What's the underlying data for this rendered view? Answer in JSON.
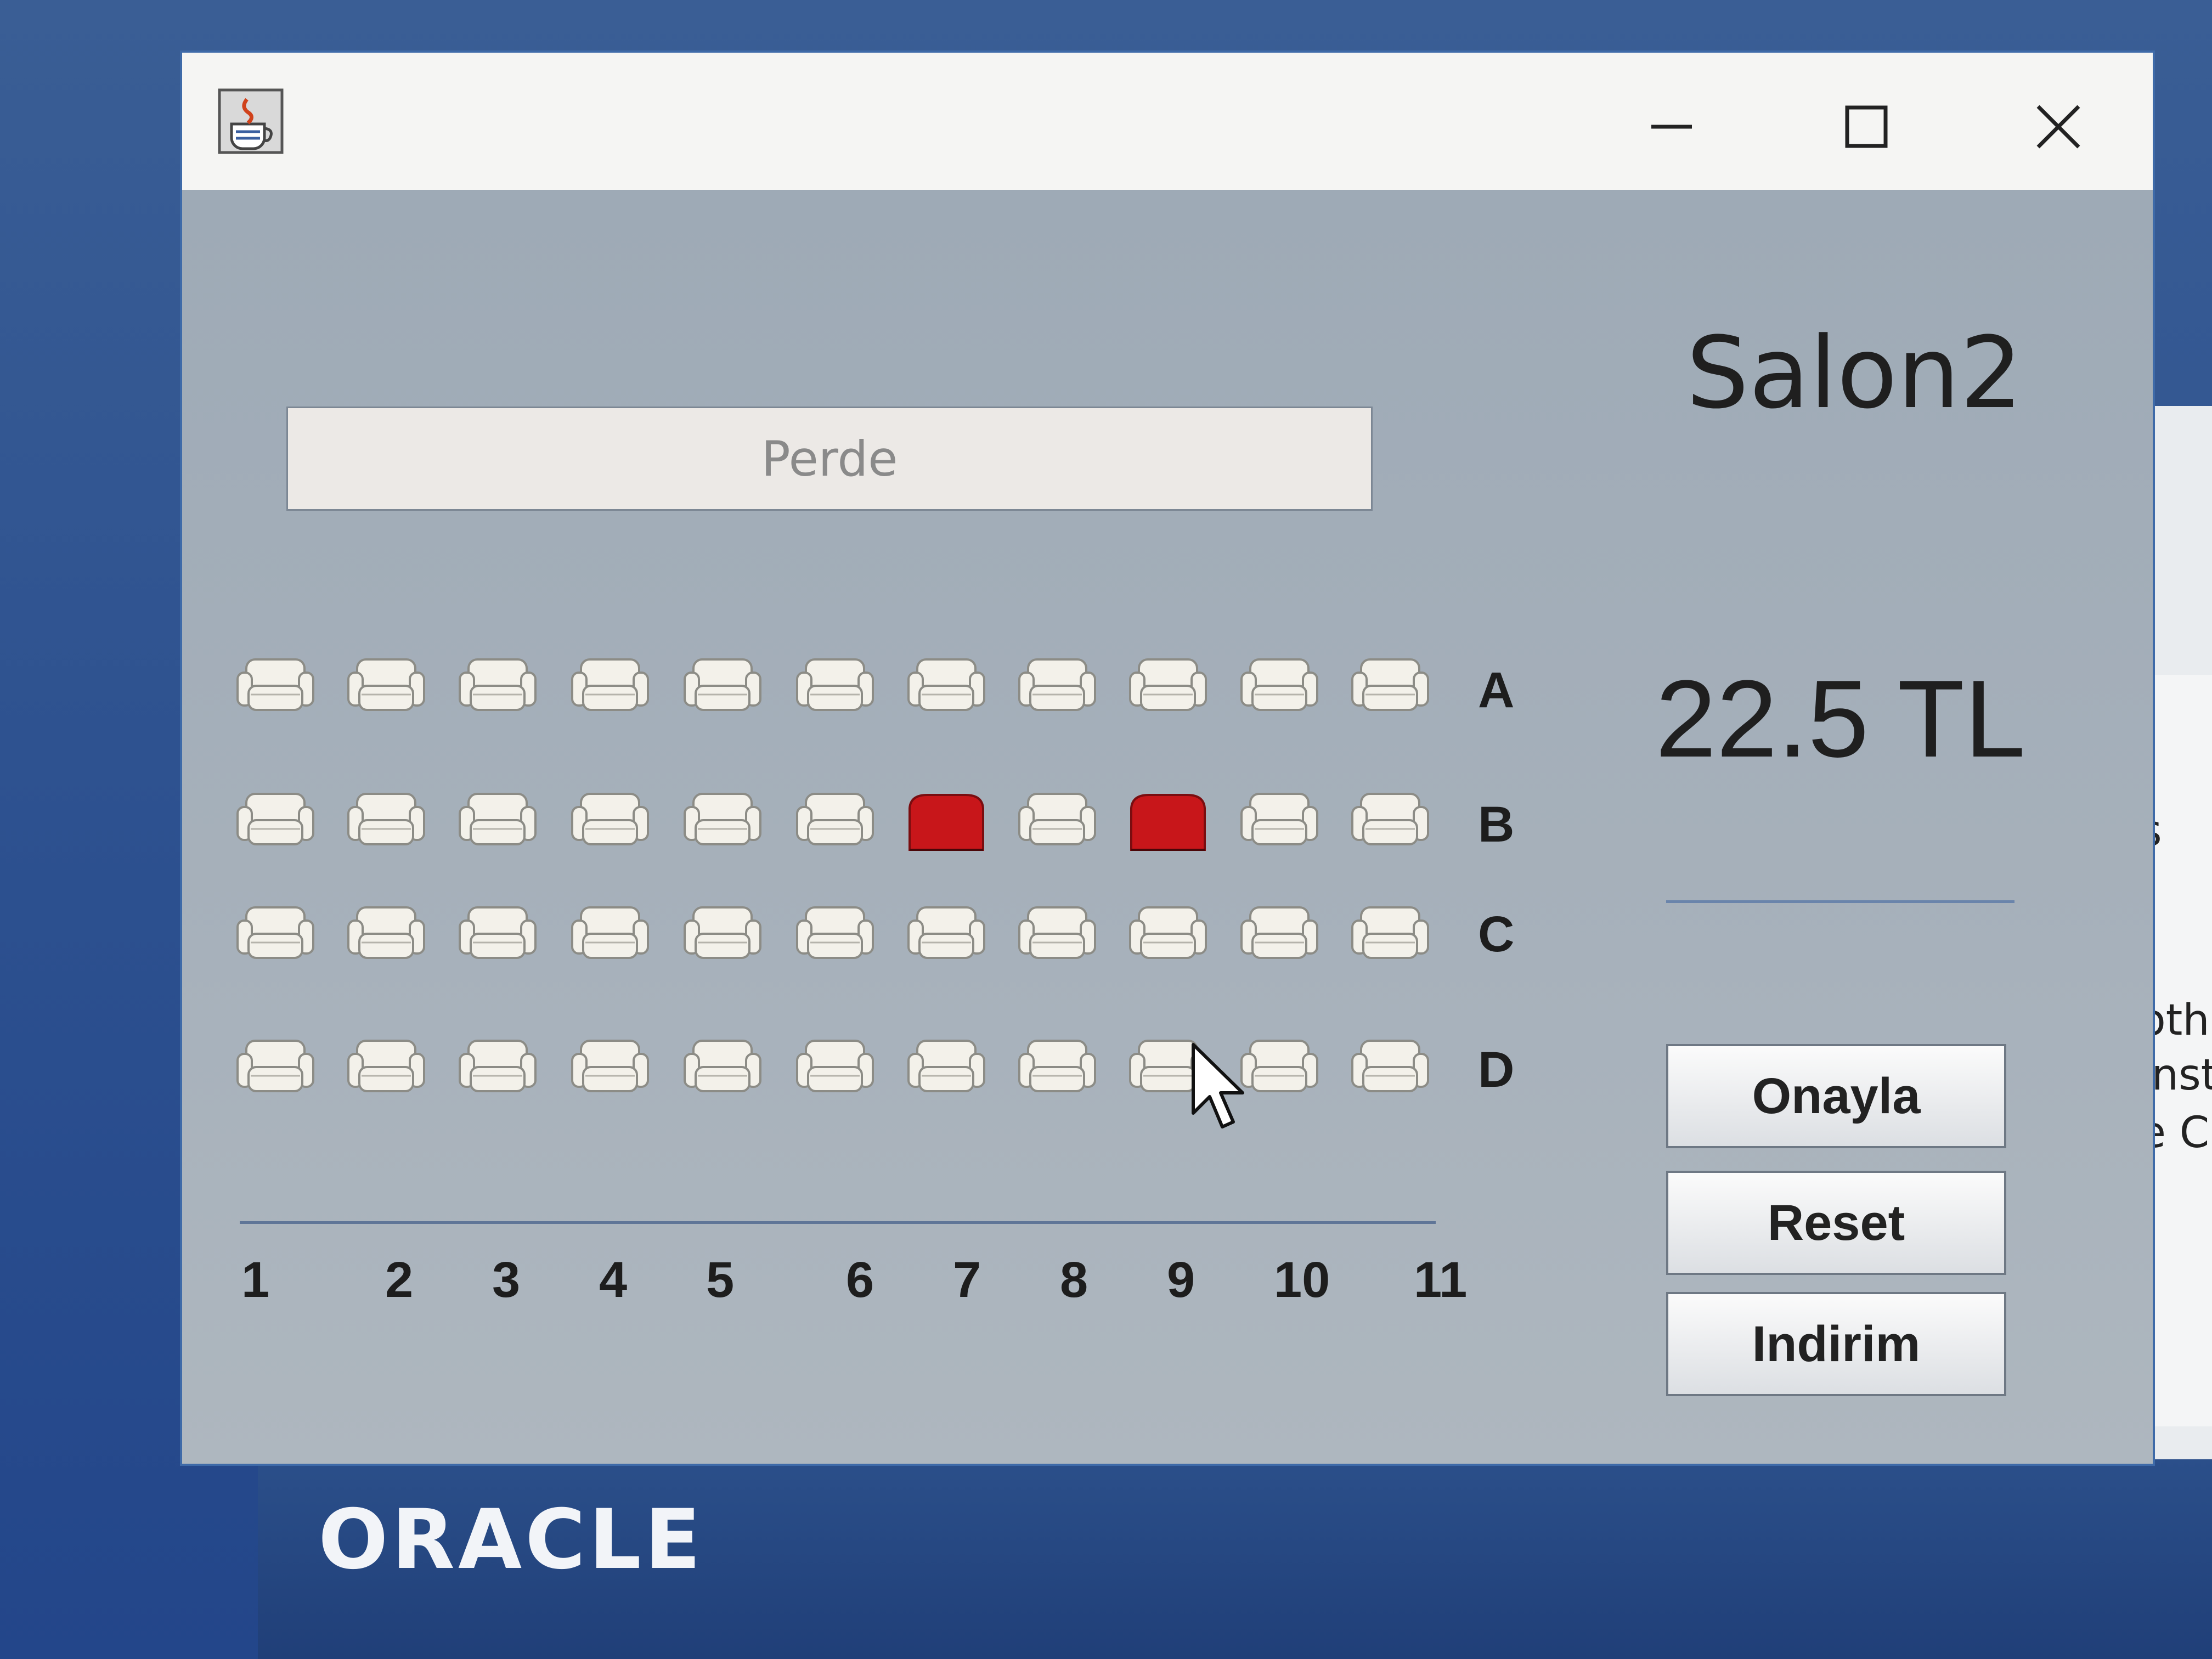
{
  "background": {
    "brand": "ORACLE",
    "right_edge_texts": [
      "oth",
      "inst",
      "e C",
      "s"
    ]
  },
  "window": {
    "title_icon": "java-cup-icon",
    "controls": [
      "minimize-icon",
      "maximize-icon",
      "close-icon"
    ]
  },
  "screen": {
    "label": "Perde"
  },
  "hall": {
    "title": "Salon2"
  },
  "seating": {
    "rows": [
      "A",
      "B",
      "C",
      "D"
    ],
    "columns": [
      "1",
      "2",
      "3",
      "4",
      "5",
      "6",
      "7",
      "8",
      "9",
      "10",
      "11"
    ],
    "selected": [
      {
        "row": "B",
        "column": "7"
      },
      {
        "row": "B",
        "column": "9"
      }
    ],
    "seat_color_free": "#f3f1ea",
    "seat_color_selected": "#c8161a"
  },
  "price": {
    "text": "22.5 TL"
  },
  "buttons": {
    "confirm": "Onayla",
    "reset": "Reset",
    "discount": "Indirim"
  }
}
